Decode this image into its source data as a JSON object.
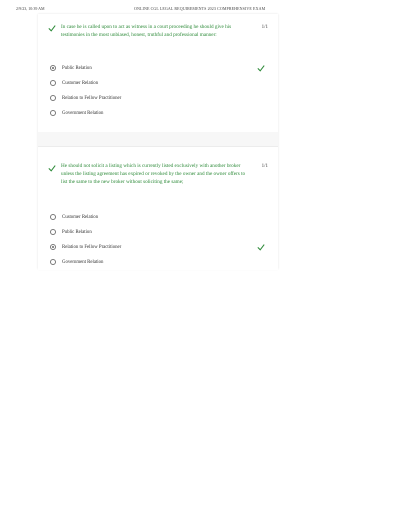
{
  "print_header": {
    "datetime": "2/9/23, 10:39 AM",
    "title": "ONLINE CGL LEGAL REQUIREMENTS 2023 COMPREHENSIVE EXAM"
  },
  "colors": {
    "correct": "#2e8b3a",
    "text": "#333333"
  },
  "questions": [
    {
      "text": "In case he is called upon to act as witness in a court proceeding he should give his testimonies in the most unbiased, honest, truthful and professional manner:",
      "score": "1/1",
      "status_icon": "check-icon",
      "options": [
        {
          "label": "Public Relation",
          "selected": true,
          "correct": true
        },
        {
          "label": "Customer Relation",
          "selected": false,
          "correct": false
        },
        {
          "label": "Relation to Fellow Practitioner",
          "selected": false,
          "correct": false
        },
        {
          "label": "Government Relation",
          "selected": false,
          "correct": false
        }
      ]
    },
    {
      "text": "He should not solicit a listing which is currently listed exclusively with another broker unless the listing agreement has expired or revoked by the owner and the owner offers to list the same to the new broker without soliciting the same;",
      "score": "1/1",
      "status_icon": "check-icon",
      "options": [
        {
          "label": "Customer Relation",
          "selected": false,
          "correct": false
        },
        {
          "label": "Public Relation",
          "selected": false,
          "correct": false
        },
        {
          "label": "Relation to Fellow Practitioner",
          "selected": true,
          "correct": true
        },
        {
          "label": "Government Relation",
          "selected": false,
          "correct": false
        }
      ]
    }
  ]
}
